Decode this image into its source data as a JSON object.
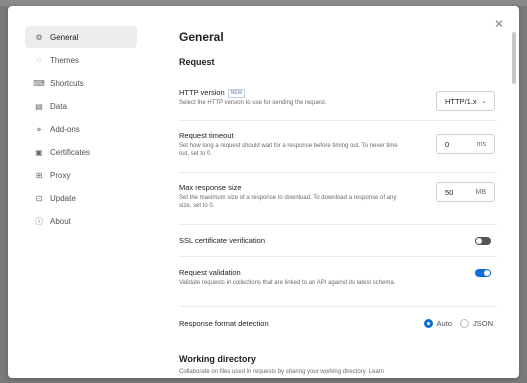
{
  "sidebar": {
    "items": [
      {
        "label": "General",
        "icon": "gear-icon",
        "glyph": "⚙",
        "active": true
      },
      {
        "label": "Themes",
        "icon": "palette-icon",
        "glyph": "◌",
        "active": false
      },
      {
        "label": "Shortcuts",
        "icon": "keyboard-icon",
        "glyph": "⌨",
        "active": false
      },
      {
        "label": "Data",
        "icon": "database-icon",
        "glyph": "▤",
        "active": false
      },
      {
        "label": "Add-ons",
        "icon": "plugin-icon",
        "glyph": "⋄",
        "active": false
      },
      {
        "label": "Certificates",
        "icon": "certificate-icon",
        "glyph": "▣",
        "active": false
      },
      {
        "label": "Proxy",
        "icon": "proxy-icon",
        "glyph": "⊞",
        "active": false
      },
      {
        "label": "Update",
        "icon": "update-icon",
        "glyph": "⊡",
        "active": false
      },
      {
        "label": "About",
        "icon": "info-icon",
        "glyph": "ⓘ",
        "active": false
      }
    ]
  },
  "main": {
    "title": "General",
    "request_section": "Request",
    "http_version": {
      "label": "HTTP version",
      "badge": "NEW",
      "desc": "Select the HTTP version to use for sending the request.",
      "value": "HTTP/1.x"
    },
    "request_timeout": {
      "label": "Request timeout",
      "desc": "Set how long a request should wait for a response before timing out. To never time out, set to 0.",
      "value": "0",
      "unit": "ms"
    },
    "max_response_size": {
      "label": "Max response size",
      "desc": "Set the maximum size of a response to download. To download a response of any size, set to 0.",
      "value": "50",
      "unit": "MB"
    },
    "ssl_verification": {
      "label": "SSL certificate verification",
      "enabled": false
    },
    "request_validation": {
      "label": "Request validation",
      "desc": "Validate requests in collections that are linked to an API against its latest schema.",
      "enabled": true
    },
    "response_format": {
      "label": "Response format detection",
      "options": [
        "Auto",
        "JSON"
      ],
      "selected": "Auto"
    },
    "working_directory": {
      "title": "Working directory",
      "desc": "Collaborate on files used in requests by sharing your working directory. Learn"
    }
  },
  "colors": {
    "accent": "#0c6fd8",
    "toggle_off": "#555555"
  }
}
